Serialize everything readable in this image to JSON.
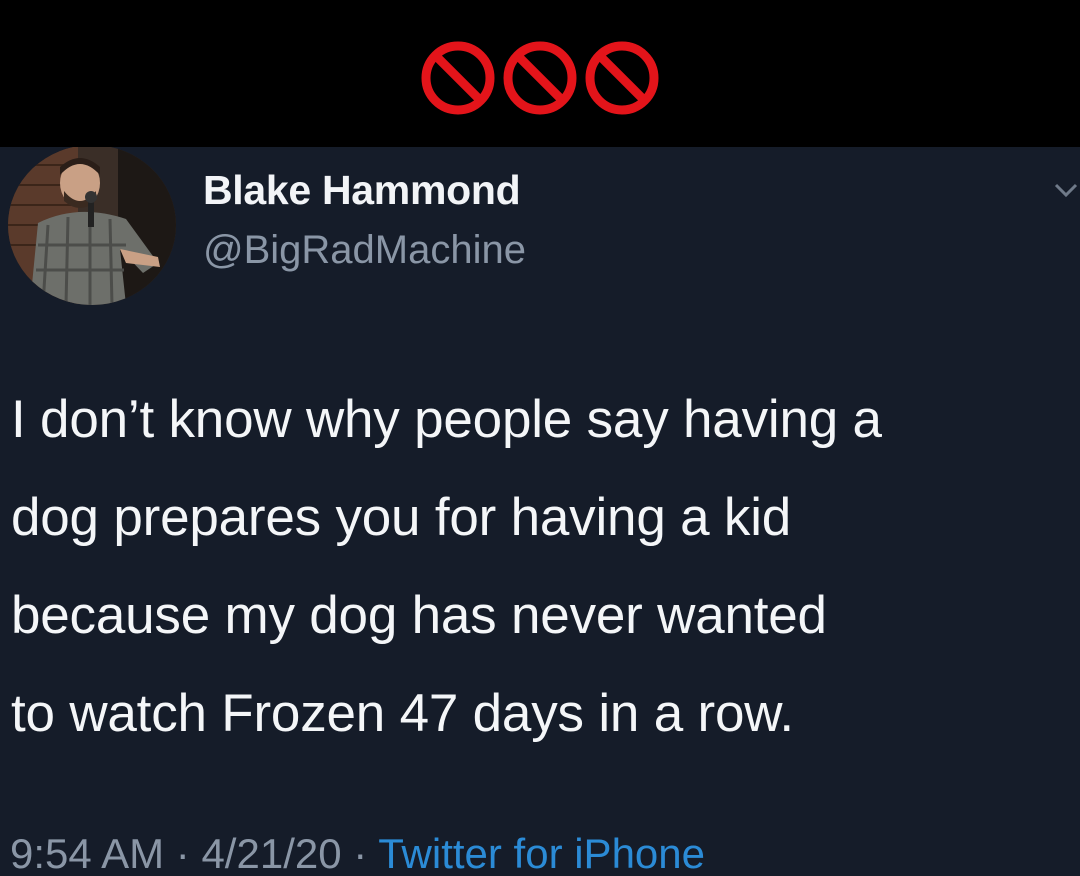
{
  "header": {
    "icons": [
      "prohibited-icon",
      "prohibited-icon",
      "prohibited-icon"
    ],
    "icon_color": "#e3141a"
  },
  "tweet": {
    "author": {
      "display_name": "Blake Hammond",
      "handle": "@BigRadMachine",
      "avatar": "avatar-photo"
    },
    "text_lines": [
      "I don’t know why people say having a",
      "dog prepares you for having a kid",
      "because my dog has never wanted",
      "to watch Frozen 47 days in a row."
    ],
    "time": "9:54 AM",
    "separator": "·",
    "date": "4/21/20",
    "source": "Twitter for iPhone",
    "menu_icon": "chevron-down-icon"
  },
  "colors": {
    "background": "#151c29",
    "text": "#f4f6f8",
    "secondary_text": "#8a96a6",
    "link": "#2b8bd6"
  }
}
